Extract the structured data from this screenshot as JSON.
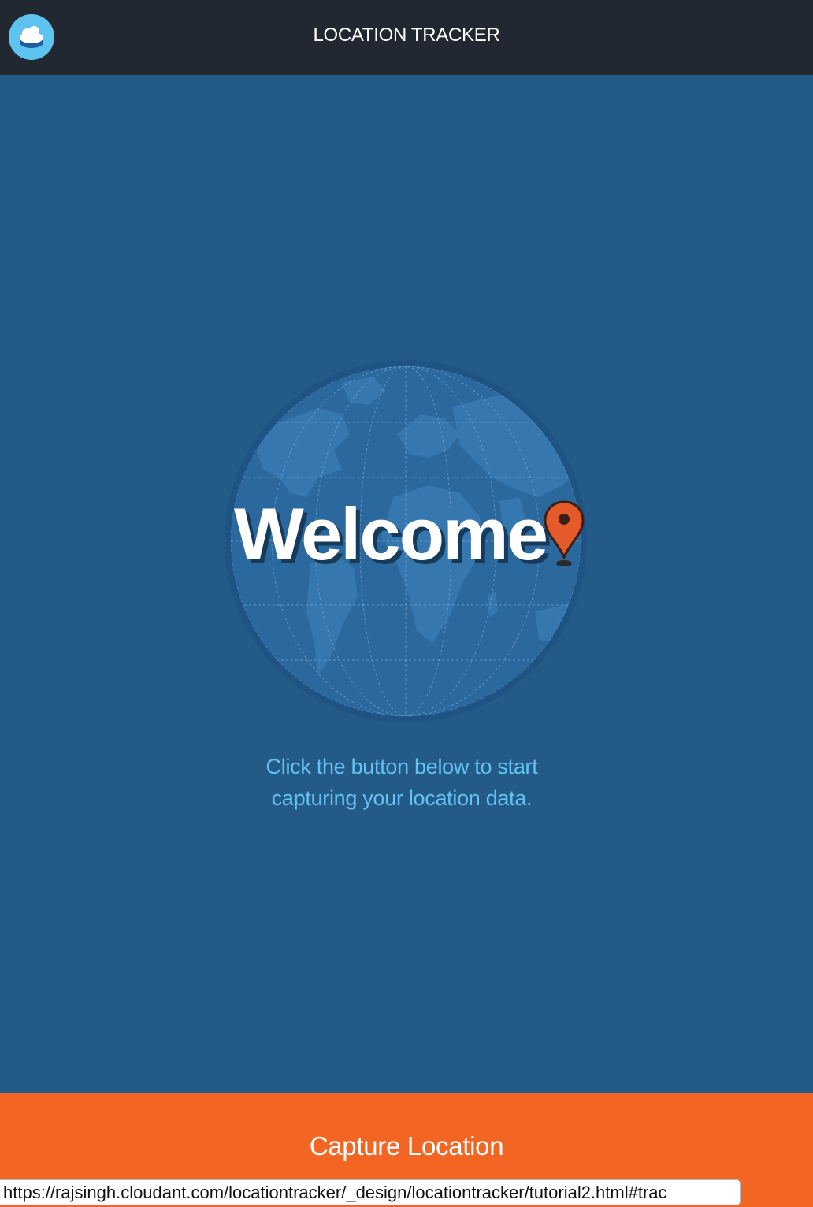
{
  "header": {
    "title": "LOCATION TRACKER",
    "logo_icon": "cloudant-logo-icon"
  },
  "main": {
    "welcome": "Welcome",
    "pin_icon": "map-pin-icon",
    "globe_icon": "globe-icon",
    "instruction_line1": "Click the button below to start",
    "instruction_line2": "capturing your location data."
  },
  "footer": {
    "capture_label": "Capture Location"
  },
  "status_bar": {
    "url": "https://rajsingh.cloudant.com/locationtracker/_design/locationtracker/tutorial2.html#trac"
  },
  "colors": {
    "header_bg": "#222831",
    "main_bg": "#235a88",
    "globe": "#2d6aa0",
    "accent": "#f36522",
    "instruction_text": "#63c3ee",
    "logo": "#5fc3ef"
  }
}
